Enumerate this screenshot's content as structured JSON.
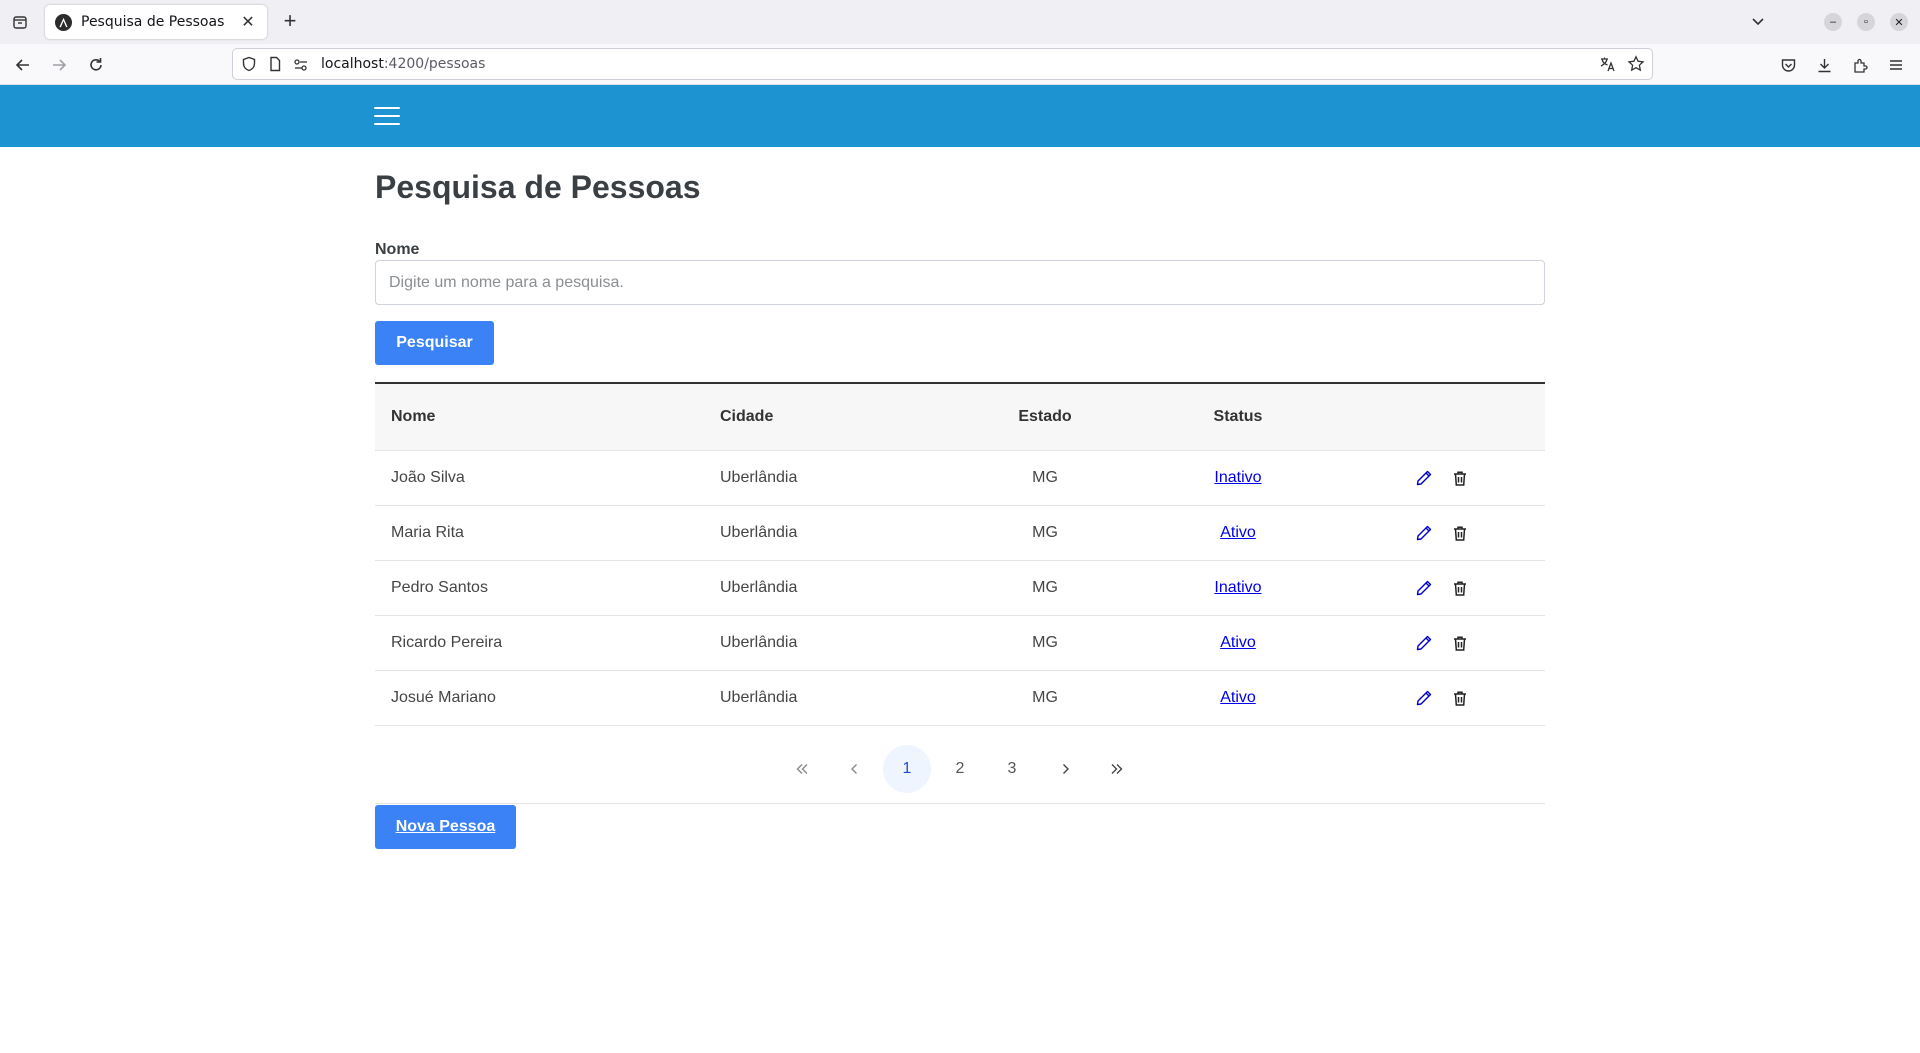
{
  "browser": {
    "tab_title": "Pesquisa de Pessoas",
    "url_host": "localhost",
    "url_path": ":4200/pessoas"
  },
  "page": {
    "title": "Pesquisa de Pessoas",
    "search_label": "Nome",
    "search_placeholder": "Digite um nome para a pesquisa.",
    "search_value": "",
    "search_button": "Pesquisar",
    "new_button": "Nova Pessoa"
  },
  "table": {
    "headers": {
      "nome": "Nome",
      "cidade": "Cidade",
      "estado": "Estado",
      "status": "Status"
    },
    "rows": [
      {
        "nome": "João Silva",
        "cidade": "Uberlândia",
        "estado": "MG",
        "status": "Inativo"
      },
      {
        "nome": "Maria Rita",
        "cidade": "Uberlândia",
        "estado": "MG",
        "status": "Ativo"
      },
      {
        "nome": "Pedro Santos",
        "cidade": "Uberlândia",
        "estado": "MG",
        "status": "Inativo"
      },
      {
        "nome": "Ricardo Pereira",
        "cidade": "Uberlândia",
        "estado": "MG",
        "status": "Ativo"
      },
      {
        "nome": "Josué Mariano",
        "cidade": "Uberlândia",
        "estado": "MG",
        "status": "Ativo"
      }
    ]
  },
  "pagination": {
    "first": "«",
    "prev": "‹",
    "pages": [
      "1",
      "2",
      "3"
    ],
    "active_page": "1",
    "next": "›",
    "last": "»"
  },
  "colors": {
    "header": "#1e93d2",
    "primary_button": "#3b82f6",
    "link": "#0000ee"
  }
}
